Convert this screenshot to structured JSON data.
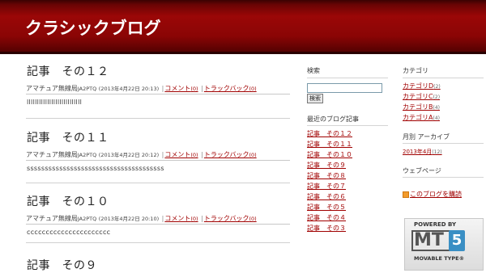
{
  "header": {
    "title": "クラシックブログ"
  },
  "entries": [
    {
      "title": "記事　その１２",
      "author": "アマチュア無線局",
      "callsign": "JA2PTQ",
      "date": "(2013年4月22日 20:13)",
      "comment": "コメント",
      "comment_count": "(0)",
      "trackback": "トラックバック",
      "trackback_count": "(0)",
      "body": "lllllllllllllllllllllllllll"
    },
    {
      "title": "記事　その１１",
      "author": "アマチュア無線局",
      "callsign": "JA2PTQ",
      "date": "(2013年4月22日 20:12)",
      "comment": "コメント",
      "comment_count": "(0)",
      "trackback": "トラックバック",
      "trackback_count": "(0)",
      "body": "ssssssssssssssssssssssssssssssssssssss"
    },
    {
      "title": "記事　その１０",
      "author": "アマチュア無線局",
      "callsign": "JA2PTQ",
      "date": "(2013年4月22日 20:10)",
      "comment": "コメント",
      "comment_count": "(0)",
      "trackback": "トラックバック",
      "trackback_count": "(0)",
      "body": "cccccccccccccccccccccc"
    },
    {
      "title": "記事　その９"
    }
  ],
  "sidebar": {
    "search": {
      "heading": "検索",
      "value": "",
      "button": "検索"
    },
    "recent": {
      "heading": "最近のブログ記事",
      "items": [
        "記事　その１２",
        "記事　その１１",
        "記事　その１０",
        "記事　その９",
        "記事　その８",
        "記事　その７",
        "記事　その６",
        "記事　その５",
        "記事　その４",
        "記事　その３"
      ]
    },
    "categories": {
      "heading": "カテゴリ",
      "items": [
        {
          "label": "カテゴリD",
          "count": "(2)"
        },
        {
          "label": "カテゴリC",
          "count": "(2)"
        },
        {
          "label": "カテゴリB",
          "count": "(4)"
        },
        {
          "label": "カテゴリA",
          "count": "(4)"
        }
      ]
    },
    "archives": {
      "heading": "月別 アーカイブ",
      "items": [
        {
          "label": "2013年4月",
          "count": "(12)"
        }
      ]
    },
    "webpages": {
      "heading": "ウェブページ"
    },
    "subscribe": {
      "label": "このブログを購読"
    },
    "badge": {
      "powered": "POWERED BY",
      "mt": "MT",
      "five": "5",
      "product": "MOVABLE TYPE®"
    }
  }
}
